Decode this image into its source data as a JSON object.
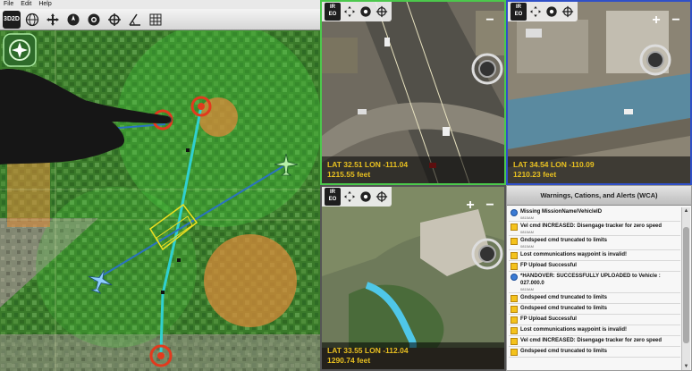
{
  "menu": {
    "file": "File",
    "edit": "Edit",
    "help": "Help"
  },
  "map_toolbar": {
    "b1": "3D",
    "b2": "2D"
  },
  "feeds": [
    {
      "ir": "IR",
      "eo": "EO",
      "lat_lon": "LAT 32.51 LON -111.04",
      "alt": "1215.55 feet",
      "border": "green"
    },
    {
      "ir": "IR",
      "eo": "EO",
      "lat_lon": "LAT 34.54 LON -110.09",
      "alt": "1210.23 feet",
      "border": "blue"
    },
    {
      "ir": "IR",
      "eo": "EO",
      "lat_lon": "LAT 33.55 LON -112.04",
      "alt": "1290.74 feet",
      "border": "gray"
    }
  ],
  "wca": {
    "title": "Warnings, Cations, and Alerts (WCA)",
    "items": [
      {
        "type": "info",
        "text": "Missing MissionName/VehicleID",
        "sub": "0815AM"
      },
      {
        "type": "warn",
        "text": "Vel cmd INCREASED: Disengage tracker for zero speed",
        "sub": "0815AM"
      },
      {
        "type": "warn",
        "text": "Gndspeed cmd truncated to limits",
        "sub": "0815AM"
      },
      {
        "type": "warn",
        "text": "Lost communications waypoint is invalid!",
        "sub": ""
      },
      {
        "type": "warn",
        "text": "FP Upload Successful",
        "sub": ""
      },
      {
        "type": "info",
        "text": "*HANDOVER: SUCCESSFULLY UPLOADED to Vehicle : 027.000.0",
        "sub": "0815AM"
      },
      {
        "type": "warn",
        "text": "Gndspeed cmd truncated to limits",
        "sub": ""
      },
      {
        "type": "warn",
        "text": "Gndspeed cmd truncated to limits",
        "sub": ""
      },
      {
        "type": "warn",
        "text": "FP Upload Successful",
        "sub": ""
      },
      {
        "type": "warn",
        "text": "Lost communications waypoint is invalid!",
        "sub": ""
      },
      {
        "type": "warn",
        "text": "Vel cmd INCREASED: Disengage tracker for zero speed",
        "sub": ""
      },
      {
        "type": "warn",
        "text": "Gndspeed cmd truncated to limits",
        "sub": ""
      }
    ]
  },
  "colors": {
    "map_green": "#3d7a2e",
    "zone_green": "#46c83c",
    "zone_orange": "#d98a3a",
    "route": "#2fd0d0",
    "threat": "#e23a1e",
    "uav": "#8fd0ff"
  }
}
